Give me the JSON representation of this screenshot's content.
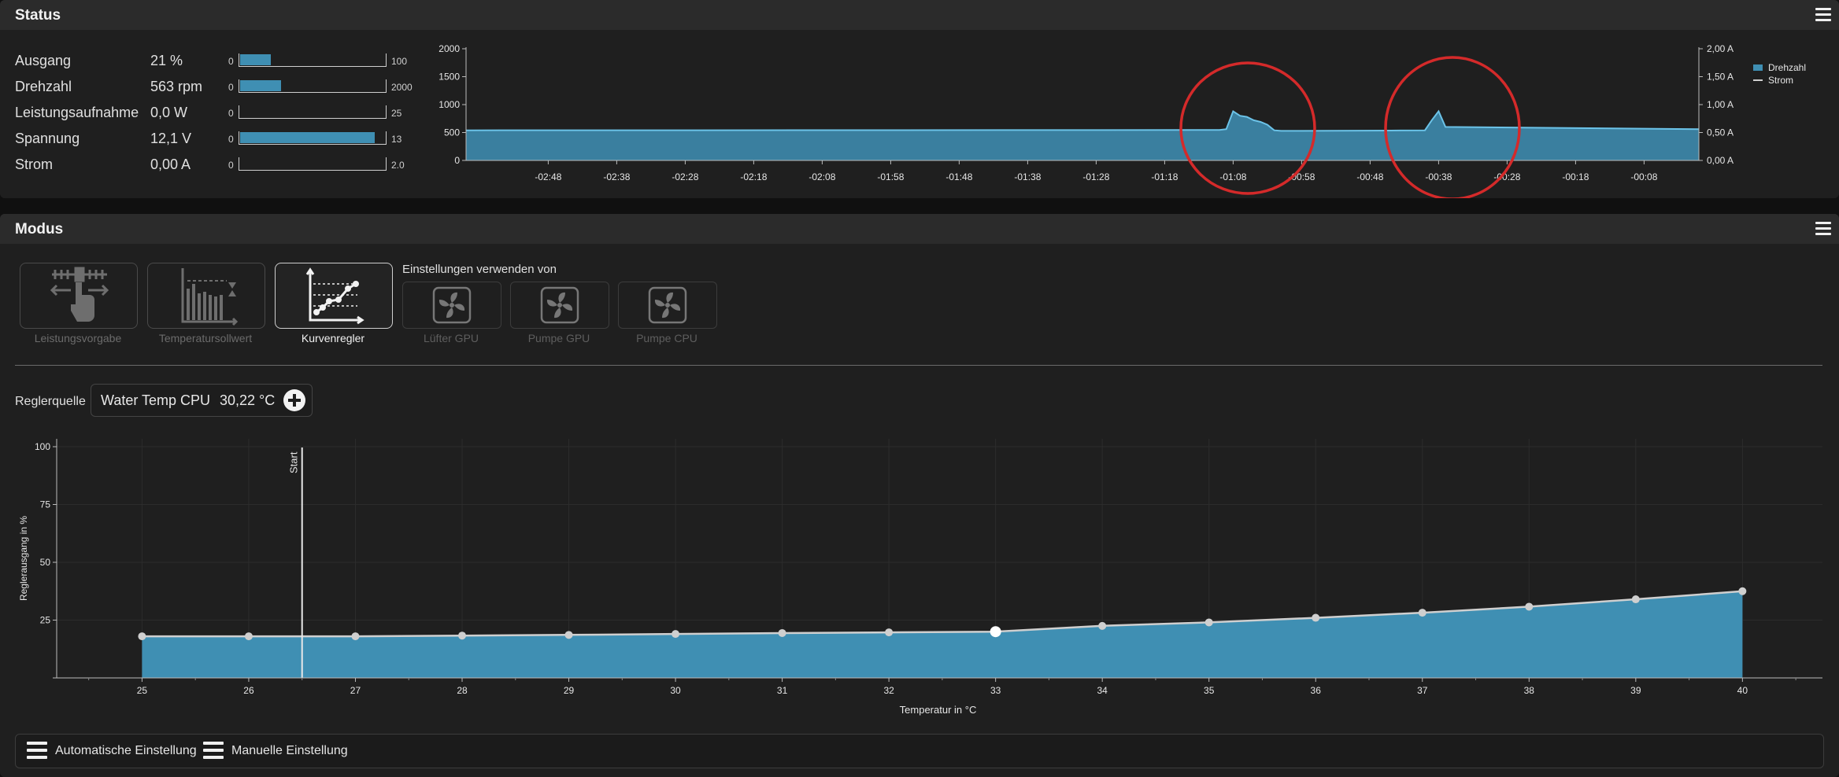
{
  "status": {
    "title": "Status",
    "rows": [
      {
        "label": "Ausgang",
        "value": "21 %",
        "min": "0",
        "max": "100",
        "fill": 0.21
      },
      {
        "label": "Drehzahl",
        "value": "563 rpm",
        "min": "0",
        "max": "2000",
        "fill": 0.28
      },
      {
        "label": "Leistungsaufnahme",
        "value": "0,0 W",
        "min": "0",
        "max": "25",
        "fill": 0
      },
      {
        "label": "Spannung",
        "value": "12,1 V",
        "min": "0",
        "max": "13",
        "fill": 0.93
      },
      {
        "label": "Strom",
        "value": "0,00 A",
        "min": "0",
        "max": "2.0",
        "fill": 0
      }
    ]
  },
  "status_chart": {
    "type": "area",
    "y_left_ticks": [
      "2000",
      "1500",
      "1000",
      "500",
      "0"
    ],
    "y_right_ticks": [
      "2,00 A",
      "1,50 A",
      "1,00 A",
      "0,50 A",
      "0,00 A"
    ],
    "x_ticks": [
      "-02:48",
      "-02:38",
      "-02:28",
      "-02:18",
      "-02:08",
      "-01:58",
      "-01:48",
      "-01:38",
      "-01:28",
      "-01:18",
      "-01:08",
      "-00:58",
      "-00:48",
      "-00:38",
      "-00:28",
      "-00:18",
      "-00:08"
    ],
    "legend": [
      {
        "name": "Drehzahl",
        "color": "#3f8fb3"
      },
      {
        "name": "Strom",
        "color": "#d0d0d0"
      }
    ],
    "series": [
      {
        "name": "Drehzahl",
        "x": [
          -180,
          -70,
          -69,
          -68,
          -67,
          -66,
          -65,
          -64,
          -63,
          -62,
          -61,
          -60,
          -45,
          -40,
          -39,
          -38,
          -37,
          0
        ],
        "values": [
          540,
          545,
          560,
          880,
          800,
          780,
          720,
          690,
          640,
          540,
          530,
          530,
          535,
          540,
          720,
          880,
          600,
          560
        ]
      },
      {
        "name": "Strom",
        "values": [
          0,
          0
        ]
      }
    ],
    "annotation_color": "#d42a2a"
  },
  "modus": {
    "title": "Modus",
    "modes": [
      {
        "label": "Leistungsvorgabe",
        "icon": "manual-hand-icon",
        "active": false
      },
      {
        "label": "Temperatursollwert",
        "icon": "target-temperature-icon",
        "active": false
      },
      {
        "label": "Kurvenregler",
        "icon": "curve-controller-icon",
        "active": true
      }
    ],
    "use_settings_label": "Einstellungen verwenden von",
    "sources": [
      {
        "label": "Lüfter GPU",
        "icon": "fan-icon"
      },
      {
        "label": "Pumpe GPU",
        "icon": "fan-icon"
      },
      {
        "label": "Pumpe CPU",
        "icon": "fan-icon"
      }
    ],
    "regler_label": "Reglerquelle",
    "source_name": "Water Temp CPU",
    "source_value": "30,22 °C"
  },
  "curve_chart": {
    "type": "line",
    "x": [
      25,
      26,
      27,
      28,
      29,
      30,
      31,
      32,
      33,
      34,
      35,
      36,
      37,
      38,
      39,
      40
    ],
    "values": [
      18,
      18,
      18,
      18.3,
      18.6,
      19,
      19.4,
      19.7,
      20,
      22.5,
      24,
      26,
      28.2,
      30.8,
      34,
      37.5
    ],
    "selected_x": 33,
    "x_ticks": [
      "25",
      "26",
      "27",
      "28",
      "29",
      "30",
      "31",
      "32",
      "33",
      "34",
      "35",
      "36",
      "37",
      "38",
      "39",
      "40"
    ],
    "y_ticks": [
      "100",
      "75",
      "50",
      "25"
    ],
    "xlabel": "Temperatur in °C",
    "ylabel": "Reglerausgang in %",
    "start_label": "Start",
    "start_x": 26.5,
    "xlim": [
      24.2,
      40.75
    ],
    "ylim": [
      0,
      100
    ],
    "fill_color": "#3f8fb3"
  },
  "bottom": {
    "auto_label": "Automatische Einstellung",
    "manual_label": "Manuelle Einstellung"
  }
}
